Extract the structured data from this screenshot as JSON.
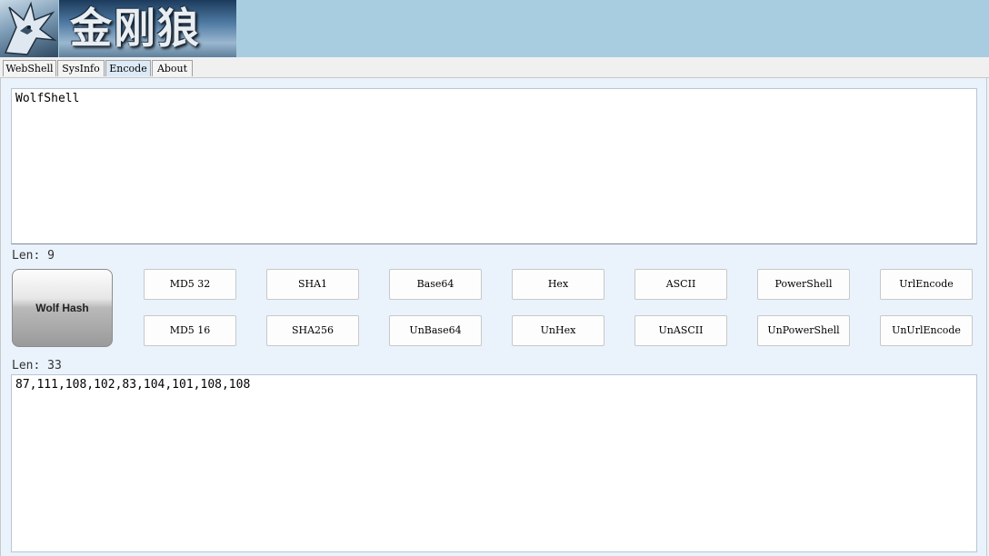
{
  "header": {
    "logo_title_text": "金刚狼"
  },
  "tabs": [
    {
      "label": "WebShell",
      "active": false
    },
    {
      "label": "SysInfo",
      "active": false
    },
    {
      "label": "Encode",
      "active": true
    },
    {
      "label": "About",
      "active": false
    }
  ],
  "encode": {
    "input_value": "WolfShell",
    "input_len_label": "Len: 9",
    "hash_button_label": "Wolf Hash",
    "buttons_row1": [
      "MD5 32",
      "SHA1",
      "Base64",
      "Hex",
      "ASCII",
      "PowerShell",
      "UrlEncode"
    ],
    "buttons_row2": [
      "MD5 16",
      "SHA256",
      "UnBase64",
      "UnHex",
      "UnASCII",
      "UnPowerShell",
      "UnUrlEncode"
    ],
    "output_len_label": "Len: 33",
    "output_value": "87,111,108,102,83,104,101,108,108"
  },
  "colors": {
    "header_bg": "#a9cde0",
    "content_bg": "#eaf3fb",
    "active_tab_bg": "#dbeaf6"
  }
}
